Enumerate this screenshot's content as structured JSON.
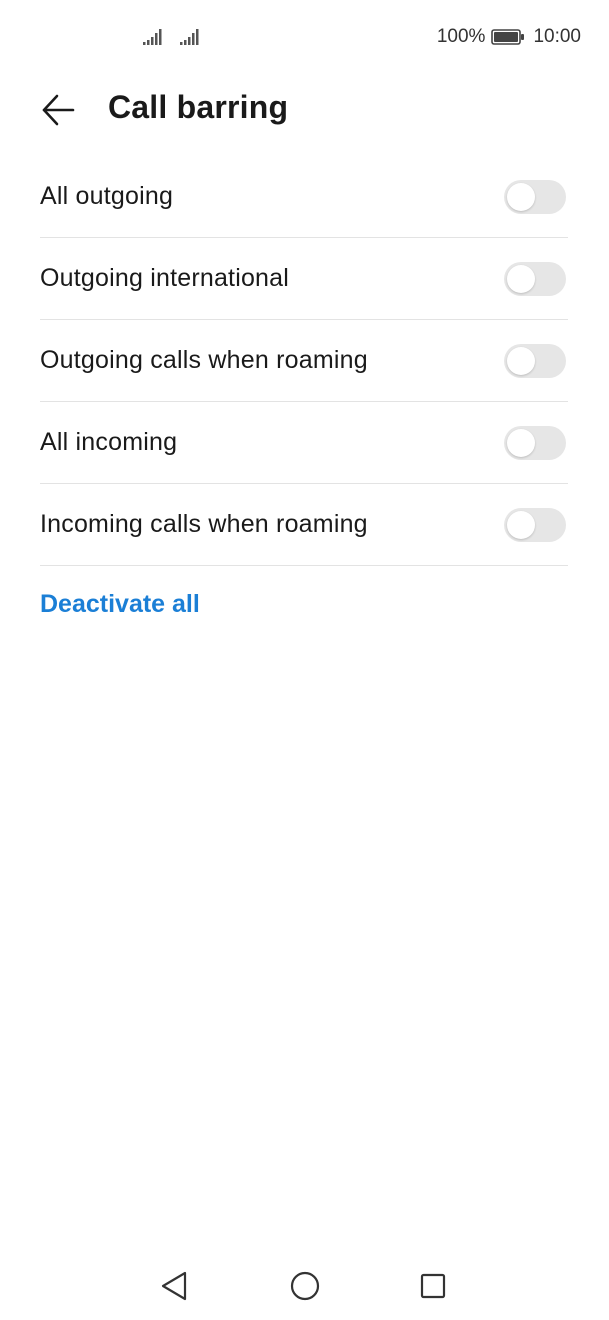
{
  "status_bar": {
    "battery_percent": "100%",
    "time": "10:00",
    "icons": [
      "signal-icon",
      "signal-icon",
      "battery-icon"
    ]
  },
  "header": {
    "title": "Call barring",
    "back_icon": "arrow-left-icon"
  },
  "settings": {
    "items": [
      {
        "label": "All outgoing",
        "enabled": false
      },
      {
        "label": "Outgoing international",
        "enabled": false
      },
      {
        "label": "Outgoing calls when roaming",
        "enabled": false
      },
      {
        "label": "All incoming",
        "enabled": false
      },
      {
        "label": "Incoming calls when roaming",
        "enabled": false
      }
    ],
    "deactivate_label": "Deactivate all"
  },
  "nav_bar": {
    "icons": [
      "nav-back-icon",
      "nav-home-icon",
      "nav-recent-icon"
    ]
  },
  "colors": {
    "accent": "#1b7fd6",
    "toggle_off": "#e6e6e6",
    "divider": "#e3e3e3"
  }
}
